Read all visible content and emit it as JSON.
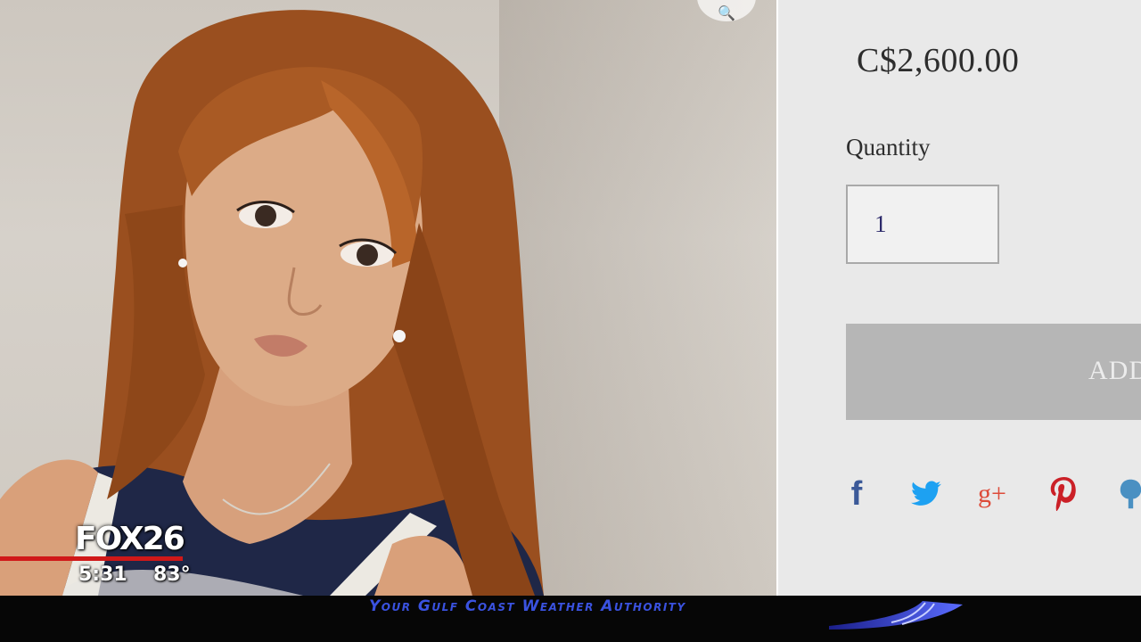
{
  "product": {
    "price": "C$2,600.00",
    "quantity_label": "Quantity",
    "quantity_value": "1",
    "add_button_label": "ADD"
  },
  "share": {
    "icons": [
      "facebook-icon",
      "twitter-icon",
      "google-plus-icon",
      "pinterest-icon",
      "fancy-icon"
    ],
    "facebook_glyph": "f",
    "google_glyph": "g+",
    "colors": {
      "facebook": "#3b5998",
      "twitter": "#1da1f2",
      "google_plus": "#dd4b39",
      "pinterest": "#cb2027",
      "fancy": "#4a90c2"
    }
  },
  "broadcast": {
    "station_logo": "FOX26",
    "time": "5:31",
    "temperature": "83°",
    "ticker_text": "Your Gulf Coast Weather Authority"
  }
}
